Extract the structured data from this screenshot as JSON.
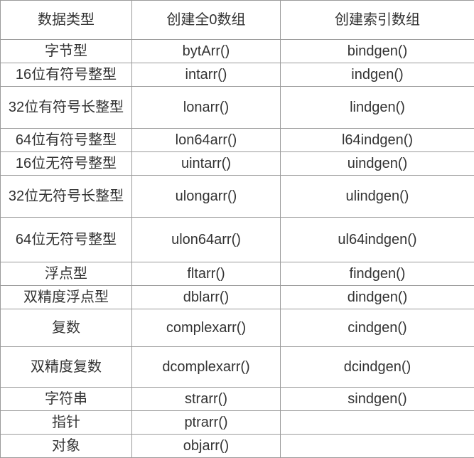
{
  "headers": {
    "c1": "数据类型",
    "c2": "创建全0数组",
    "c3": "创建索引数组"
  },
  "rows": [
    {
      "type": "字节型",
      "zero": "bytArr()",
      "index": "bindgen()"
    },
    {
      "type": "16位有符号整型",
      "zero": "intarr()",
      "index": "indgen()"
    },
    {
      "type": "32位有符号长整型",
      "zero": "lonarr()",
      "index": "lindgen()"
    },
    {
      "type": "64位有符号整型",
      "zero": "lon64arr()",
      "index": "l64indgen()"
    },
    {
      "type": "16位无符号整型",
      "zero": "uintarr()",
      "index": "uindgen()"
    },
    {
      "type": "32位无符号长整型",
      "zero": "ulongarr()",
      "index": "ulindgen()"
    },
    {
      "type": "64位无符号整型",
      "zero": "ulon64arr()",
      "index": "ul64indgen()"
    },
    {
      "type": "浮点型",
      "zero": "fltarr()",
      "index": "findgen()"
    },
    {
      "type": "双精度浮点型",
      "zero": "dblarr()",
      "index": "dindgen()"
    },
    {
      "type": "复数",
      "zero": "complexarr()",
      "index": "cindgen()"
    },
    {
      "type": "双精度复数",
      "zero": "dcomplexarr()",
      "index": "dcindgen()"
    },
    {
      "type": "字符串",
      "zero": "strarr()",
      "index": "sindgen()"
    },
    {
      "type": "指针",
      "zero": "ptrarr()",
      "index": ""
    },
    {
      "type": "对象",
      "zero": "objarr()",
      "index": ""
    }
  ]
}
